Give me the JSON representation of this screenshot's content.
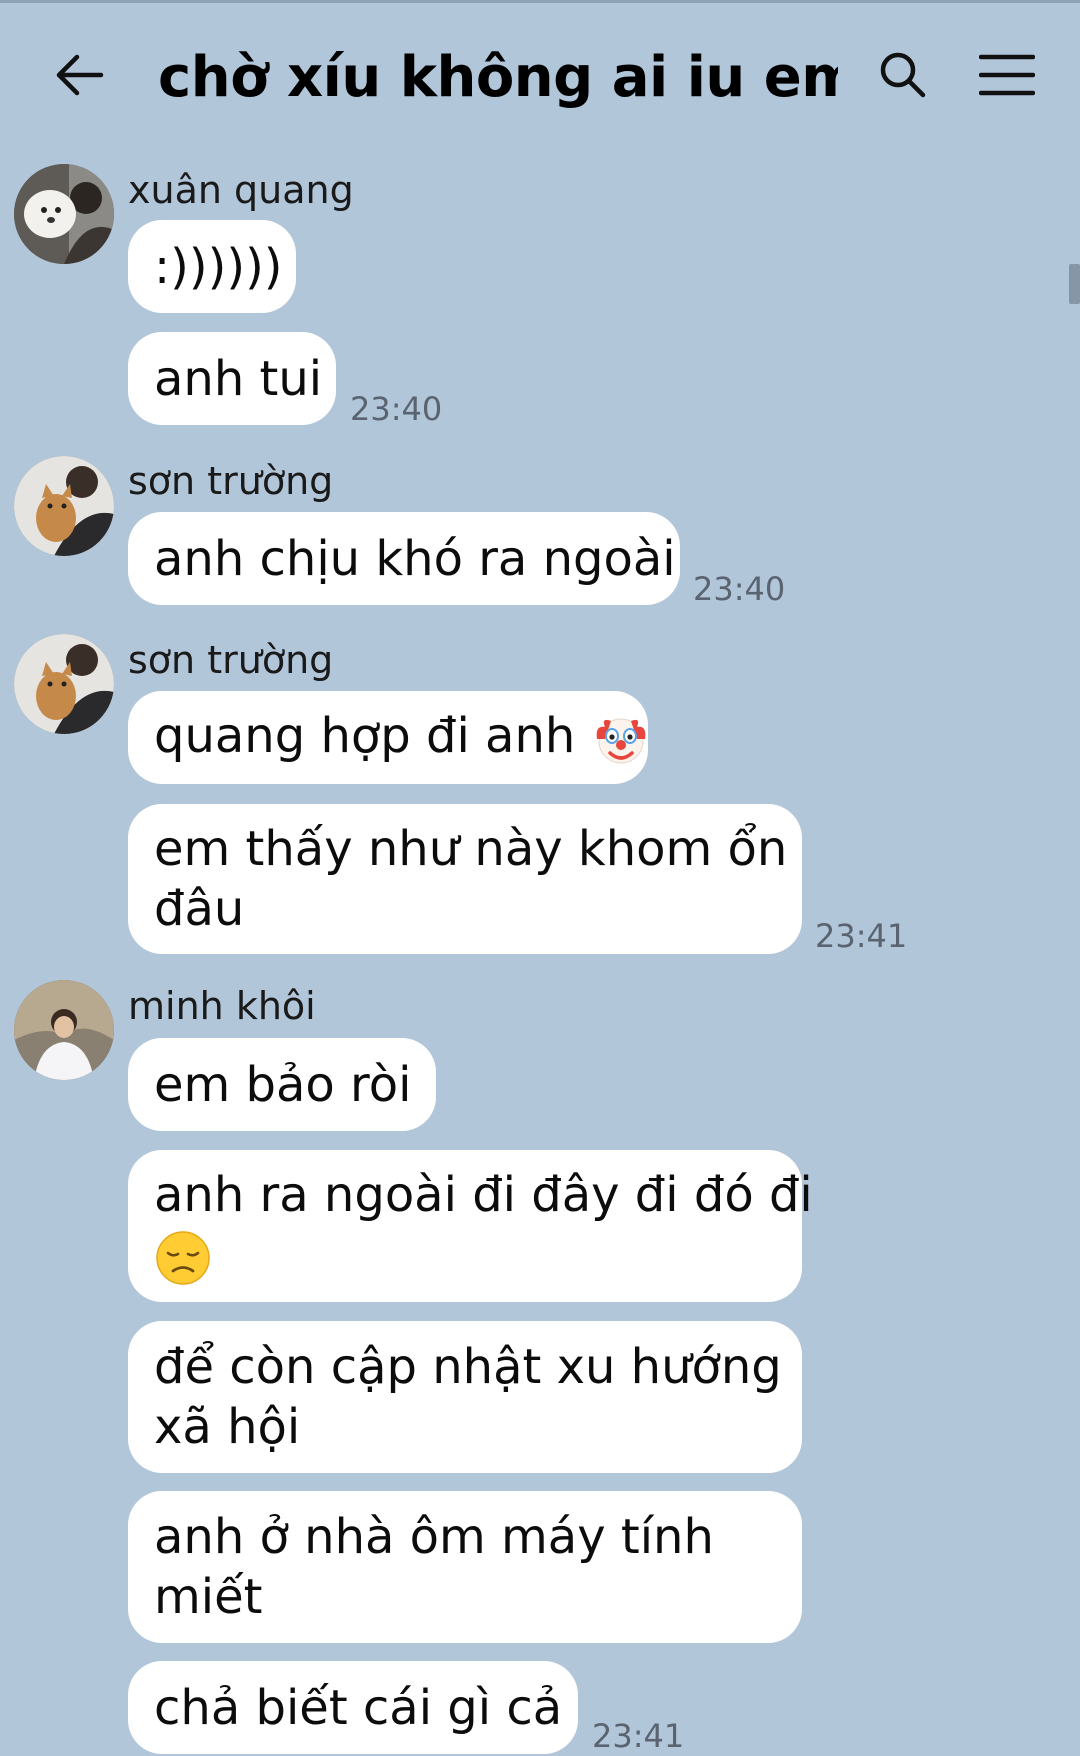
{
  "header": {
    "back_icon": "arrow-left-icon",
    "title": "chờ xíu không ai iu em...",
    "search_icon": "search-icon",
    "menu_icon": "hamburger-menu-icon"
  },
  "messages": [
    {
      "sender": "xuân quang",
      "avatar": "avatar-xuan-quang"
    },
    {
      "text": ":))))))"
    },
    {
      "text": "anh tui",
      "time": "23:40"
    },
    {
      "sender": "sơn trường",
      "avatar": "avatar-son-truong"
    },
    {
      "text": "anh chịu khó ra ngoài",
      "time": "23:40"
    },
    {
      "sender": "sơn trường",
      "avatar": "avatar-son-truong"
    },
    {
      "text": "quang hợp đi anh",
      "emoji": "clown-face-emoji"
    },
    {
      "lines": [
        "em thấy như này khom ổn",
        "đâu"
      ],
      "time": "23:41"
    },
    {
      "sender": "minh khôi",
      "avatar": "avatar-minh-khoi"
    },
    {
      "text": "em bảo ròi"
    },
    {
      "lines": [
        "anh ra ngoài đi đây đi đó đi"
      ],
      "emoji": "disappointed-face-emoji"
    },
    {
      "lines": [
        "để còn cập nhật xu hướng",
        "xã hội"
      ]
    },
    {
      "lines": [
        "anh ở nhà ôm máy tính",
        "miết"
      ]
    },
    {
      "text": "chả biết cái gì cả",
      "time": "23:41"
    }
  ],
  "colors": {
    "background": "#b2c6da",
    "bubble": "#ffffff",
    "timestamp": "#5a6470"
  }
}
